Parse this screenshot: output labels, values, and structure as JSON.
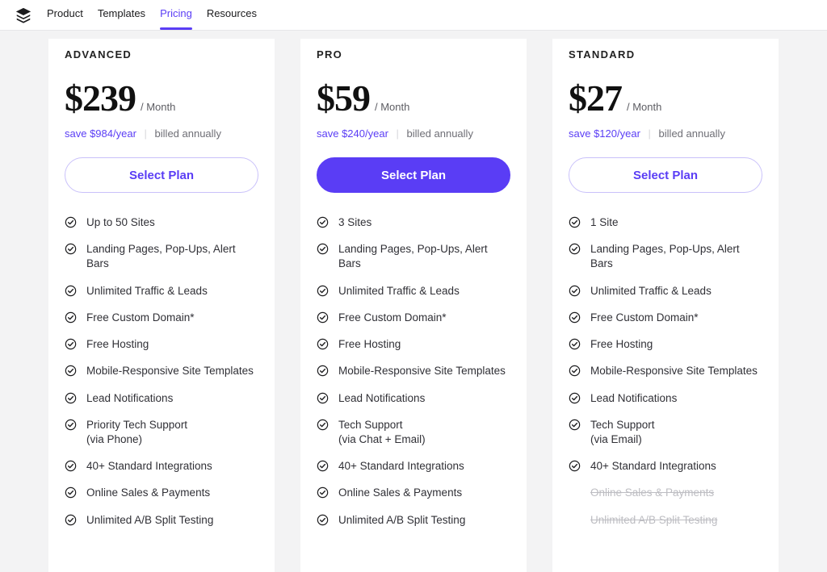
{
  "nav": {
    "product": "Product",
    "templates": "Templates",
    "pricing": "Pricing",
    "resources": "Resources"
  },
  "common": {
    "per_month": "/ Month",
    "billed": "billed annually",
    "select": "Select Plan"
  },
  "plans": [
    {
      "name": "ADVANCED",
      "price": "$239",
      "save": "save $984/year",
      "primary": false,
      "features": [
        {
          "t": "Up to 50 Sites",
          "on": true
        },
        {
          "t": "Landing Pages, Pop-Ups, Alert Bars",
          "on": true
        },
        {
          "t": "Unlimited Traffic & Leads",
          "on": true
        },
        {
          "t": "Free Custom Domain*",
          "on": true
        },
        {
          "t": "Free Hosting",
          "on": true
        },
        {
          "t": "Mobile-Responsive Site Templates",
          "on": true
        },
        {
          "t": "Lead Notifications",
          "on": true
        },
        {
          "t": "Priority Tech Support\n(via Phone)",
          "on": true
        },
        {
          "t": "40+ Standard Integrations",
          "on": true
        },
        {
          "t": "Online Sales & Payments",
          "on": true
        },
        {
          "t": "Unlimited A/B Split Testing",
          "on": true
        }
      ]
    },
    {
      "name": "PRO",
      "price": "$59",
      "save": "save $240/year",
      "primary": true,
      "features": [
        {
          "t": "3 Sites",
          "on": true
        },
        {
          "t": "Landing Pages, Pop-Ups, Alert Bars",
          "on": true
        },
        {
          "t": "Unlimited Traffic & Leads",
          "on": true
        },
        {
          "t": "Free Custom Domain*",
          "on": true
        },
        {
          "t": "Free Hosting",
          "on": true
        },
        {
          "t": "Mobile-Responsive Site Templates",
          "on": true
        },
        {
          "t": "Lead Notifications",
          "on": true
        },
        {
          "t": "Tech Support\n(via Chat + Email)",
          "on": true
        },
        {
          "t": "40+ Standard Integrations",
          "on": true
        },
        {
          "t": "Online Sales & Payments",
          "on": true
        },
        {
          "t": "Unlimited A/B Split Testing",
          "on": true
        }
      ]
    },
    {
      "name": "STANDARD",
      "price": "$27",
      "save": "save $120/year",
      "primary": false,
      "features": [
        {
          "t": "1 Site",
          "on": true
        },
        {
          "t": "Landing Pages, Pop-Ups, Alert Bars",
          "on": true
        },
        {
          "t": "Unlimited Traffic & Leads",
          "on": true
        },
        {
          "t": "Free Custom Domain*",
          "on": true
        },
        {
          "t": "Free Hosting",
          "on": true
        },
        {
          "t": "Mobile-Responsive Site Templates",
          "on": true
        },
        {
          "t": "Lead Notifications",
          "on": true
        },
        {
          "t": "Tech Support\n(via Email)",
          "on": true
        },
        {
          "t": "40+ Standard Integrations",
          "on": true
        },
        {
          "t": "Online Sales & Payments",
          "on": false
        },
        {
          "t": "Unlimited A/B Split Testing",
          "on": false
        }
      ]
    }
  ]
}
